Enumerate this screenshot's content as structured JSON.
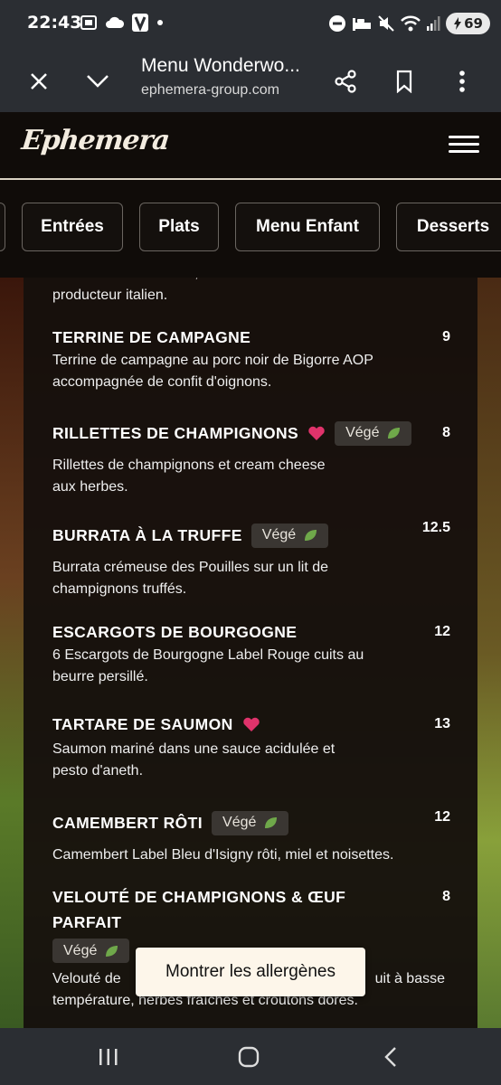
{
  "status_bar": {
    "time": "22:43",
    "battery": "69",
    "left_icons": [
      "screenshot-icon",
      "cloud-icon",
      "app-v-icon",
      "dot-icon"
    ],
    "right_icons": [
      "do-not-disturb-icon",
      "sleep-icon",
      "mute-icon",
      "wifi-icon",
      "signal-icon",
      "battery-icon"
    ]
  },
  "browser": {
    "title": "Menu Wonderwo...",
    "url": "ephemera-group.com"
  },
  "site": {
    "logo": "Ephemera"
  },
  "categories": [
    "Entrées",
    "Plats",
    "Menu Enfant",
    "Desserts"
  ],
  "menu": {
    "partial_top": {
      "line1": "Jambon cuit à la truffe, en direct de notre",
      "line2": "producteur italien."
    },
    "items": [
      {
        "name": "TERRINE DE CAMPAGNE",
        "price": "9",
        "desc1": "Terrine de campagne au porc noir de Bigorre AOP",
        "desc2": "accompagnée de confit d'oignons."
      },
      {
        "name": "RILLETTES DE CHAMPIGNONS",
        "price": "8",
        "tag": "Végé",
        "desc1": "Rillettes de champignons et cream cheese",
        "desc2": "aux herbes."
      },
      {
        "name": "BURRATA À LA TRUFFE",
        "price": "12.5",
        "tag": "Végé",
        "desc1": "Burrata crémeuse des Pouilles sur un lit de",
        "desc2": "champignons truffés."
      },
      {
        "name": "ESCARGOTS DE BOURGOGNE",
        "price": "12",
        "desc1": "6 Escargots de Bourgogne Label Rouge cuits au",
        "desc2": "beurre persillé."
      },
      {
        "name": "TARTARE DE SAUMON",
        "price": "13",
        "desc1": "Saumon mariné dans une sauce acidulée et",
        "desc2": "pesto d'aneth."
      },
      {
        "name": "CAMEMBERT RÔTI",
        "price": "12",
        "tag": "Végé",
        "desc1": "Camembert Label Bleu d'Isigny rôti, miel et noisettes."
      },
      {
        "name1": "VELOUTÉ DE CHAMPIGNONS & ŒUF",
        "name2": "PARFAIT",
        "price": "8",
        "tag": "Végé",
        "desc1_start": "Velouté de",
        "desc1_end": "uit à basse",
        "desc2": "température, herbes fraîches et croûtons dorés."
      }
    ]
  },
  "allergens_button": "Montrer les allergènes",
  "colors": {
    "heart": "#e0336b",
    "leaf": "#6fa84a",
    "panel": "#16100d"
  }
}
